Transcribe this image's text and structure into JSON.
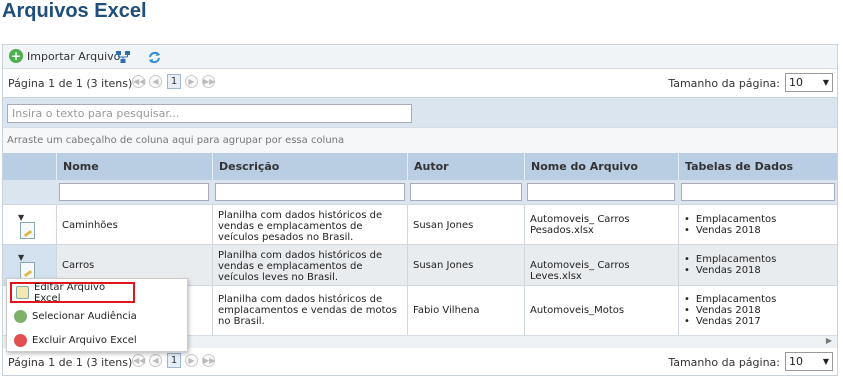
{
  "page": {
    "title": "Arquivos Excel"
  },
  "toolbar": {
    "import_label": "Importar Arquivo",
    "hierarchy_icon": "hierarchy-icon",
    "refresh_icon": "refresh-icon"
  },
  "pager": {
    "text": "Página 1 de 1 (3 itens)",
    "current_page": "1",
    "page_size_label": "Tamanho da página:",
    "page_size": "10"
  },
  "search": {
    "placeholder": "Insira o texto para pesquisar..."
  },
  "group_hint": "Arraste um cabeçalho de coluna aqui para agrupar por essa coluna",
  "columns": [
    "Nome",
    "Descrição",
    "Autor",
    "Nome do Arquivo",
    "Tabelas de Dados"
  ],
  "rows": [
    {
      "nome": "Caminhões",
      "descricao": "Planilha com dados históricos de vendas e emplacamentos de veículos pesados no Brasil.",
      "autor": "Susan Jones",
      "arquivo": "Automoveis_ Carros Pesados.xlsx",
      "tabelas": [
        "Emplacamentos",
        "Vendas 2018"
      ]
    },
    {
      "nome": "Carros",
      "descricao": "Planilha com dados históricos de vendas e emplacamentos de veículos leves no Brasil.",
      "autor": "Susan Jones",
      "arquivo": "Automoveis_ Carros Leves.xlsx",
      "tabelas": [
        "Emplacamentos",
        "Vendas 2018"
      ]
    },
    {
      "nome": "",
      "descricao": "Planilha com dados históricos de emplacamentos e vendas de motos no Brasil.",
      "autor": "Fabio Vilhena",
      "arquivo": "Automoveis_Motos",
      "tabelas": [
        "Emplacamentos",
        "Vendas 2018",
        "Vendas 2017"
      ]
    }
  ],
  "context_menu": {
    "items": [
      {
        "label": "Editar Arquivo Excel",
        "icon": "edit-icon"
      },
      {
        "label": "Selecionar Audiência",
        "icon": "audience-icon"
      },
      {
        "label": "Excluir Arquivo Excel",
        "icon": "delete-icon"
      }
    ]
  },
  "colors": {
    "accent": "#e0161d",
    "header": "#b9cde3",
    "title": "#1f4e7a"
  }
}
